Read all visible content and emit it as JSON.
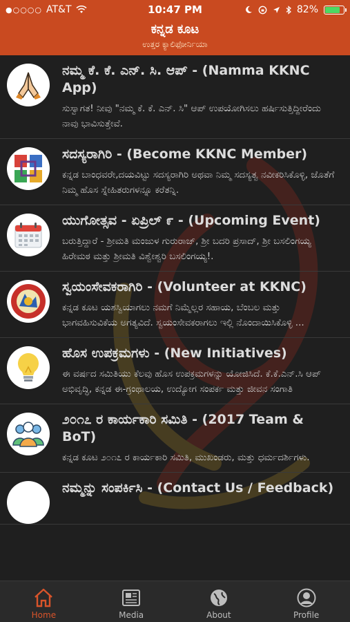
{
  "status_bar": {
    "signal": "●○○○○",
    "carrier": "AT&T",
    "time": "10:47 PM",
    "battery_text": "82%",
    "battery_level": 0.82
  },
  "header": {
    "title": "ಕನ್ನಡ ಕೂಟ",
    "subtitle": "ಉತ್ತರ ಕ್ಯಾಲಿಫೋರ್ನಿಯಾ"
  },
  "items": [
    {
      "title": "ನಮ್ಮ ಕೆ. ಕೆ. ಎನ್. ಸಿ. ಆಪ್ - (Namma KKNC App)",
      "desc": "ಸುಸ್ವಾಗತ! ನೀವು \"ನಮ್ಮ ಕೆ. ಕೆ. ಎನ್. ಸಿ\" ಆಪ್ ಉಪಯೋಗಿಸಲು ಹರ್ಷಿಸುತ್ತಿದ್ದೀರೆಂದು ನಾವು ಭಾವಿಸುತ್ತೇವೆ.",
      "icon": "namaste-hands-icon"
    },
    {
      "title": "ಸದಸ್ಯರಾಗಿರಿ - (Become KKNC Member)",
      "desc": "ಕನ್ನಡ ಬಾಂಧವರೇ,ದಯವಿಟ್ಟು ಸದಸ್ಯರಾಗಿರಿ ಅಥವಾ ನಿಮ್ಮ ಸದಸ್ಯತ್ವ ನವೀಕರಿಸಿಕೊಳ್ಳಿ, ಜೊತೆಗೆ ನಿಮ್ಮ ಹೊಸ ಸ್ನೇಹಿತರುಗಳನ್ನೂ ಕರೆತನ್ನಿ.",
      "icon": "community-hands-icon"
    },
    {
      "title": "ಯುಗೋತ್ಸವ - ಏಪ್ರಿಲ್ ೯ - (Upcoming Event)",
      "desc": "ಬರುತ್ತಿದ್ದಾರೆ - ಶ್ರೀಮತಿ ಮಂಜುಳ ಗುರುರಾಜ್, ಶ್ರೀ ಬದರಿ ಪ್ರಸಾದ್, ಶ್ರೀ ಬಸಲಿಂಗಯ್ಯ ಹಿರೇಮಠ ಮತ್ತು ಶ್ರೀಮತಿ ವಿಶ್ವೇಶ್ವರಿ ಬಸಲಿಂಗಯ್ಯ!.",
      "icon": "calendar-icon"
    },
    {
      "title": "ಸ್ವಯಂಸೇವಕರಾಗಿರಿ - (Volunteer at KKNC)",
      "desc": "ಕನ್ನಡ ಕೂಟ ಯಶಸ್ವಿಯಾಗಲು ನಮಗೆ ನಿಮ್ಮೆಲ್ಲರ ಸಹಾಯ, ಬೆಂಬಲ ಮತ್ತು ಭಾಗವಹಿಸುವಿಕೆಯ ಅಗತ್ಯವಿದೆ. ಸ್ವಯಂಸೇವಕರಾಗಲು ಇಲ್ಲಿ ನೊಂದಾಯಿಸಿಕೊಳ್ಳಿ ...",
      "icon": "volunteer-logo-icon"
    },
    {
      "title": "ಹೊಸ ಉಪಕ್ರಮಗಳು - (New Initiatives)",
      "desc": "ಈ ವರ್ಷದ ಸಮಿತಿಯು ಕೆಲವು ಹೊಸ ಉಪಕ್ರಮಗಳನ್ನು ಯೋಜಿಸಿದೆ. ಕೆ.ಕೆ.ಎನ್.ಸಿ ಆಪ್ ಅಭಿವೃದ್ಧಿ, ಕನ್ನಡ ಈ-ಗ್ರಂಥಾಲಯ, ಉದ್ಯೋಗ ಸಂಪರ್ಕ ಮತ್ತು ಜೀವನ ಸಂಗಾತಿ",
      "icon": "lightbulb-icon"
    },
    {
      "title": "೨೦೧೭ ರ ಕಾರ್ಯಕಾರಿ ಸಮಿತಿ - (2017 Team & BoT)",
      "desc": "ಕನ್ನಡ ಕೂಟ ೨೦೧೭ ರ ಕಾರ್ಯಕಾರಿ ಸಮಿತಿ, ಮುಖಂಡರು, ಮತ್ತು ಧರ್ಮದರ್ಶಿಗಳು.",
      "icon": "team-people-icon"
    },
    {
      "title": "ನಮ್ಮನ್ನು ಸಂಪರ್ಕಿಸಿ - (Contact Us / Feedback)",
      "desc": "",
      "icon": "contact-icon"
    }
  ],
  "tabs": [
    {
      "label": "Home",
      "icon": "home-icon",
      "active": true
    },
    {
      "label": "Media",
      "icon": "newspaper-icon",
      "active": false
    },
    {
      "label": "About",
      "icon": "globe-icon",
      "active": false
    },
    {
      "label": "Profile",
      "icon": "person-icon",
      "active": false
    }
  ],
  "colors": {
    "header_bg": "#c94a20",
    "background": "#1f1f1f",
    "active_tab": "#d9542a"
  }
}
